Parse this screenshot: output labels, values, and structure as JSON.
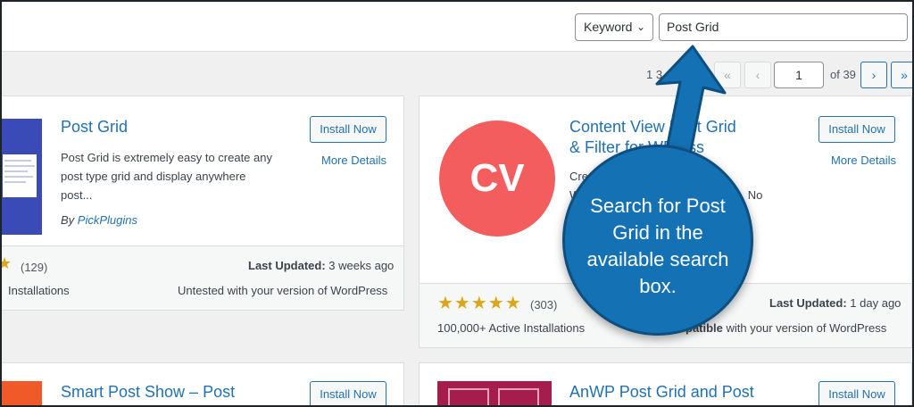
{
  "search": {
    "type_label": "Keyword",
    "query": "Post Grid"
  },
  "pagination": {
    "count_partial": "1 3",
    "first": "«",
    "prev": "‹",
    "current": "1",
    "of": "of 39",
    "next": "›",
    "last": "»"
  },
  "plugins": [
    {
      "title": "Post Grid",
      "install": "Install Now",
      "more": "More Details",
      "description": "Post Grid is extremely easy to create any post type grid and display anywhere post...",
      "desc_lines": [
        "Post Grid is extremely easy to create any",
        "post type grid and display anywhere",
        "post..."
      ],
      "author_prefix": "By",
      "author": "PickPlugins",
      "rating_count": "(129)",
      "updated_label": "Last Updated:",
      "updated_value": "3 weeks ago",
      "installs": "Installations",
      "compat": "Untested with your version of WordPress"
    },
    {
      "title_lines": [
        "Content Views",
        "& Filter for WordPress"
      ],
      "title_line1_a": "Content View",
      "title_line1_b": "Post Grid",
      "title_line2": "& Filter for W",
      "title_line2_b": "Press",
      "install": "Install Now",
      "more": "More Details",
      "desc_a": "Cre",
      "desc_b": "s. No",
      "desc_c": "W",
      "logo_text": "CV",
      "stars": "★★★★★",
      "rating_count": "(303)",
      "updated_label": "Last Updated:",
      "updated_value": "1 day ago",
      "installs": "100,000+ Active Installations",
      "compat_b": "patible",
      "compat_rest": "with your version of WordPress"
    },
    {
      "title": "Smart Post Show – Post",
      "install": "Install Now"
    },
    {
      "title": "AnWP Post Grid and Post",
      "install": "Install Now"
    }
  ],
  "callout": {
    "lines": [
      "Search for Post",
      "Grid in the",
      "available search",
      "box."
    ]
  },
  "colors": {
    "accent": "#2271b1",
    "callout": "#1471b3",
    "cv_logo": "#f45d5d",
    "star": "#dba617"
  }
}
